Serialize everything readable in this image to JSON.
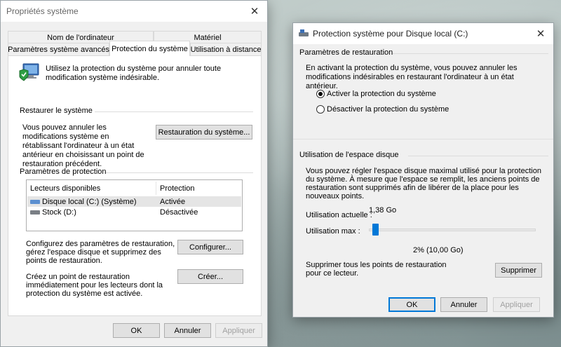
{
  "left_window": {
    "title": "Propriétés système",
    "tabs_row1": [
      "Nom de l'ordinateur",
      "Matériel"
    ],
    "tabs_row2": [
      "Paramètres système avancés",
      "Protection du système",
      "Utilisation à distance"
    ],
    "intro_text": "Utilisez la protection du système pour annuler toute modification système indésirable.",
    "restore_section_title": "Restaurer le système",
    "restore_text": "Vous pouvez annuler les modifications système en rétablissant l'ordinateur à un état antérieur en choisissant un point de restauration précédent.",
    "restore_button": "Restauration du système...",
    "protection_section_title": "Paramètres de protection",
    "table_headers": [
      "Lecteurs disponibles",
      "Protection"
    ],
    "drives": [
      {
        "name": "Disque local (C:) (Système)",
        "protection": "Activée",
        "icon": "system-drive-icon"
      },
      {
        "name": "Stock (D:)",
        "protection": "Désactivée",
        "icon": "drive-icon"
      }
    ],
    "configure_text": "Configurez des paramètres de restauration, gérez l'espace disque et supprimez des points de restauration.",
    "configure_button": "Configurer...",
    "create_text": "Créez un point de restauration immédiatement pour les lecteurs dont la protection du système est activée.",
    "create_button": "Créer...",
    "ok_button": "OK",
    "cancel_button": "Annuler",
    "apply_button": "Appliquer"
  },
  "right_window": {
    "title": "Protection système pour Disque local (C:)",
    "restore_settings_title": "Paramètres de restauration",
    "restore_settings_text": "En activant la protection du système, vous pouvez annuler les modifications indésirables en restaurant l'ordinateur à un état antérieur.",
    "radio_enable": "Activer la protection du système",
    "radio_disable": "Désactiver la protection du système",
    "selected_radio": "enable",
    "disk_usage_title": "Utilisation de l'espace disque",
    "disk_usage_text": "Vous pouvez régler l'espace disque maximal utilisé pour la protection du système. À mesure que l'espace se remplit, les anciens points de restauration sont supprimés afin de libérer de la place pour les nouveaux points.",
    "current_usage_label": "Utilisation actuelle :",
    "current_usage_value": "1,38 Go",
    "max_usage_label": "Utilisation max :",
    "slider_percent": 2,
    "slider_value_text": "2% (10,00 Go)",
    "delete_text": "Supprimer tous les points de restauration pour ce lecteur.",
    "delete_button": "Supprimer",
    "ok_button": "OK",
    "cancel_button": "Annuler",
    "apply_button": "Appliquer"
  }
}
